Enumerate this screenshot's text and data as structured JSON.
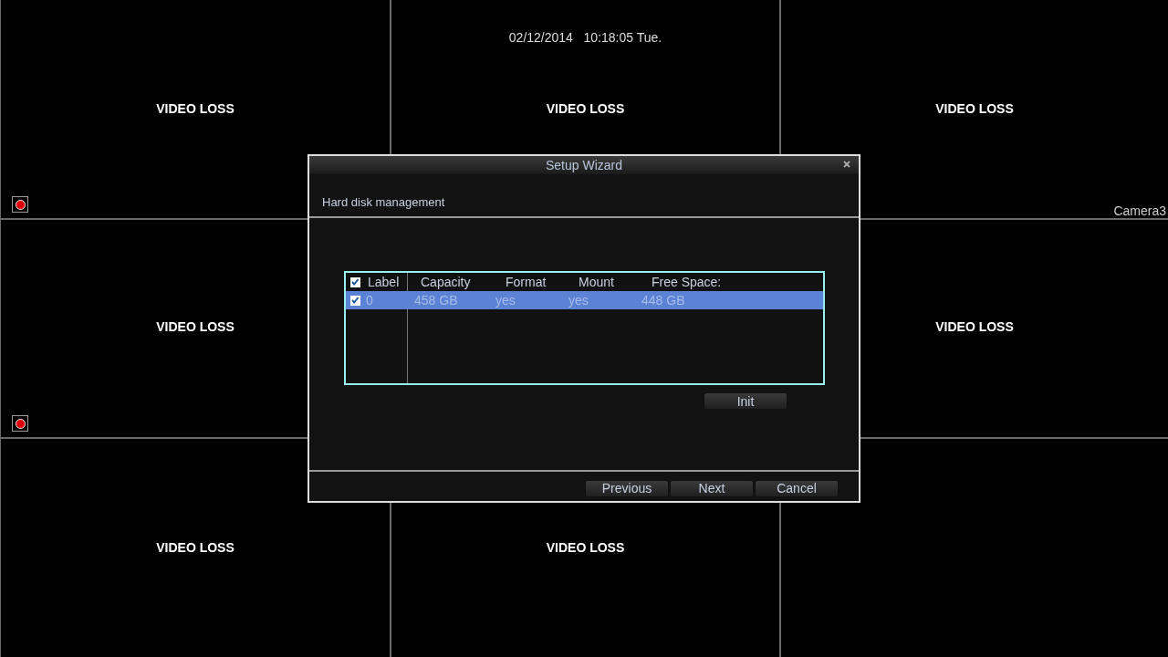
{
  "cells": [
    {
      "text": "VIDEO LOSS",
      "recording": true
    },
    {
      "text": "VIDEO LOSS",
      "recording": false,
      "timestamp": "02/12/2014   10:18:05 Tue."
    },
    {
      "text": "VIDEO LOSS",
      "recording": false,
      "camera": "Camera3"
    },
    {
      "text": "VIDEO LOSS",
      "recording": true
    },
    {
      "text": "VIDEO LOSS",
      "recording": false
    },
    {
      "text": "VIDEO LOSS",
      "recording": false
    },
    {
      "text": "VIDEO LOSS",
      "recording": false
    },
    {
      "recording": false
    }
  ],
  "dialog": {
    "title": "Setup Wizard",
    "section": "Hard disk management",
    "table": {
      "all_checked": true,
      "columns": [
        "Label",
        "Capacity",
        "Format",
        "Mount",
        "Free Space:"
      ],
      "rows": [
        {
          "checked": true,
          "selected": true,
          "cells": [
            "0",
            "458 GB",
            "yes",
            "yes",
            "448 GB"
          ]
        }
      ]
    },
    "init_button": "Init",
    "buttons": [
      "Previous",
      "Next",
      "Cancel"
    ]
  }
}
